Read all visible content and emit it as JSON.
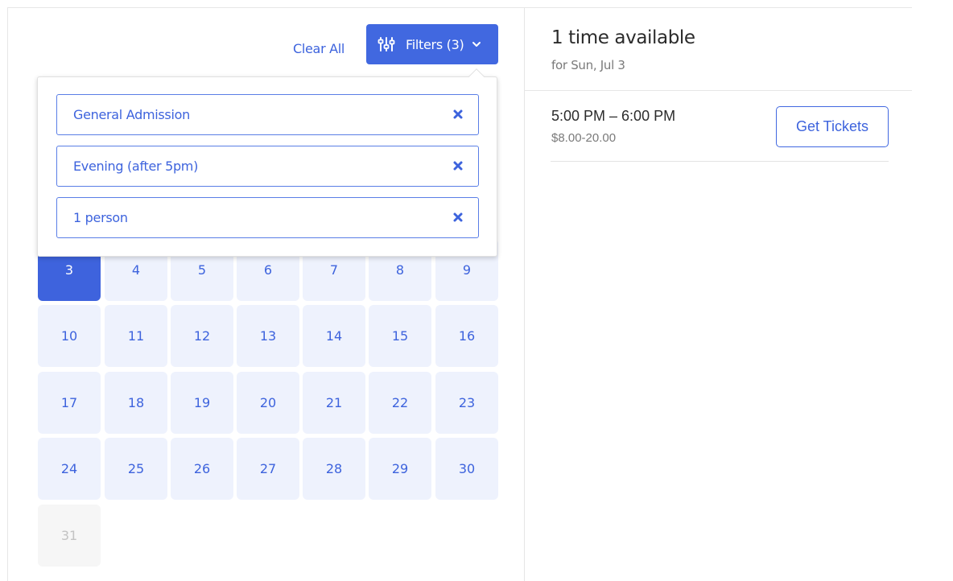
{
  "toolbar": {
    "clear_all_label": "Clear All",
    "filters_label": "Filters (3)",
    "sliders_icon": "sliders-icon",
    "chevron_icon": "chevron-down-icon"
  },
  "filters": {
    "chips": [
      {
        "label": "General Admission",
        "remove_icon": "close-icon"
      },
      {
        "label": "Evening (after 5pm)",
        "remove_icon": "close-icon"
      },
      {
        "label": "1 person",
        "remove_icon": "close-icon"
      }
    ]
  },
  "calendar": {
    "selected_day": "3",
    "rows": [
      [
        "3",
        "4",
        "5",
        "6",
        "7",
        "8",
        "9"
      ],
      [
        "10",
        "11",
        "12",
        "13",
        "14",
        "15",
        "16"
      ],
      [
        "17",
        "18",
        "19",
        "20",
        "21",
        "22",
        "23"
      ],
      [
        "24",
        "25",
        "26",
        "27",
        "28",
        "29",
        "30"
      ],
      [
        "31"
      ]
    ],
    "disabled_days": [
      "31"
    ]
  },
  "availability": {
    "title": "1 time available",
    "subtitle": "for Sun, Jul 3",
    "slots": [
      {
        "time": "5:00 PM – 6:00 PM",
        "price": "$8.00-20.00",
        "button_label": "Get Tickets"
      }
    ]
  },
  "colors": {
    "accent": "#4168e0",
    "cell_bg": "#eef2fd",
    "disabled_bg": "#f6f6f6"
  }
}
